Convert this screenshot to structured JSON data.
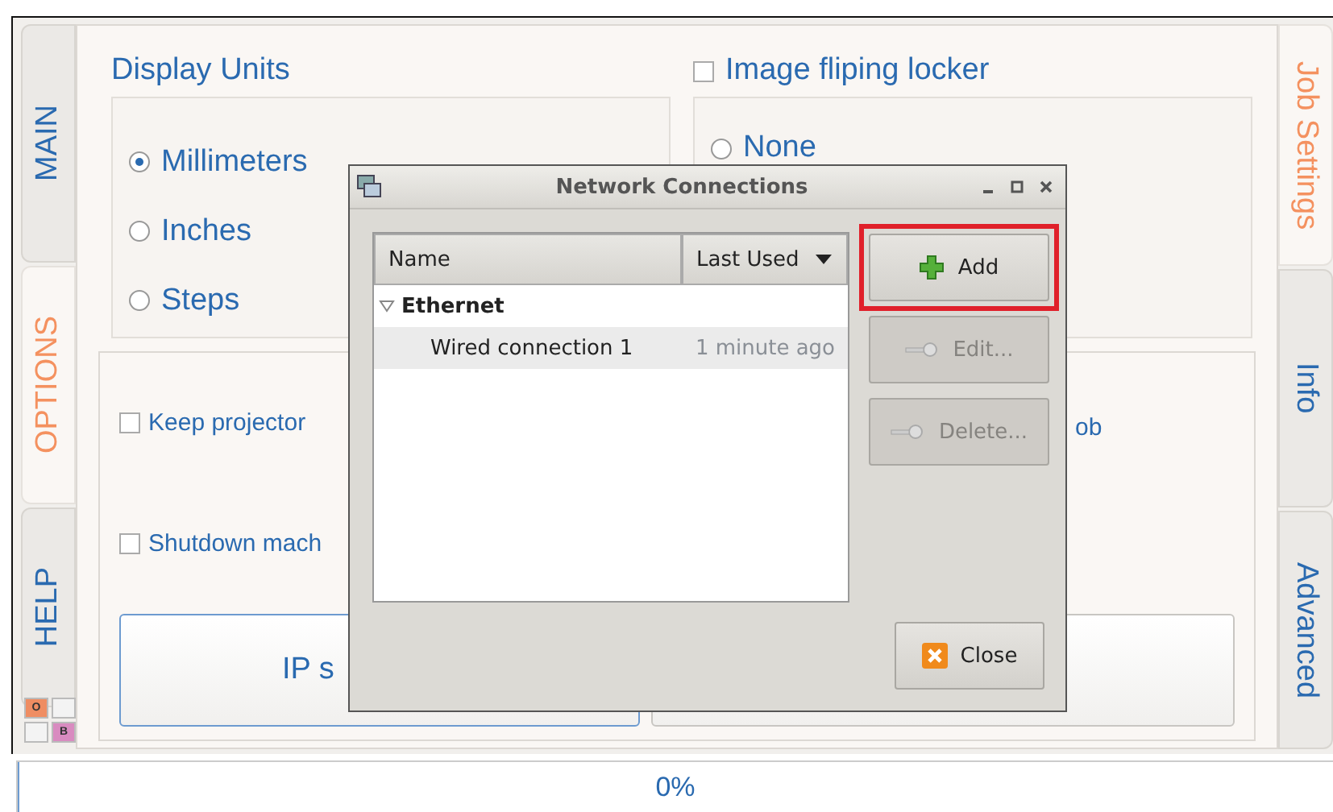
{
  "left_tabs": [
    {
      "label": "MAIN",
      "selected": false
    },
    {
      "label": "OPTIONS",
      "selected": true
    },
    {
      "label": "HELP",
      "selected": false
    }
  ],
  "indicators": [
    {
      "label": "O",
      "color": "#ef8d62"
    },
    {
      "color": "#f3f3f3"
    },
    {
      "color": "#f3f3f3"
    },
    {
      "label": "B",
      "color": "#d98bc0"
    }
  ],
  "right_tabs": [
    {
      "label": "Job Settings",
      "selected": true
    },
    {
      "label": "Info",
      "selected": false
    },
    {
      "label": "Advanced",
      "selected": false
    }
  ],
  "display_units": {
    "title": "Display Units",
    "options": [
      {
        "label": "Millimeters",
        "selected": true
      },
      {
        "label": "Inches",
        "selected": false
      },
      {
        "label": "Steps",
        "selected": false
      }
    ]
  },
  "image_flipping": {
    "label": "Image fliping locker",
    "checked": false,
    "options": [
      {
        "label": "None",
        "selected": false
      }
    ]
  },
  "options_box": {
    "checkboxes": [
      {
        "label": "Keep projector",
        "checked": false
      },
      {
        "label": "Shutdown mach",
        "checked": false
      }
    ],
    "fragment": "ob",
    "buttons": [
      "IP s"
    ]
  },
  "dialog": {
    "title": "Network Connections",
    "columns": [
      {
        "label": "Name",
        "sorted": false
      },
      {
        "label": "Last Used",
        "sorted": true
      }
    ],
    "groups": [
      {
        "label": "Ethernet",
        "expanded": true,
        "children": [
          {
            "name": "Wired connection 1",
            "last_used": "1 minute ago",
            "selected": true
          }
        ]
      }
    ],
    "buttons": [
      {
        "kind": "add",
        "label": "Add",
        "disabled": false,
        "highlighted": true
      },
      {
        "kind": "edit",
        "label": "Edit...",
        "disabled": true,
        "highlighted": false
      },
      {
        "kind": "delete",
        "label": "Delete...",
        "disabled": true,
        "highlighted": false
      }
    ],
    "close": "Close"
  },
  "status_bar": {
    "progress": "0%",
    "level": 0
  }
}
